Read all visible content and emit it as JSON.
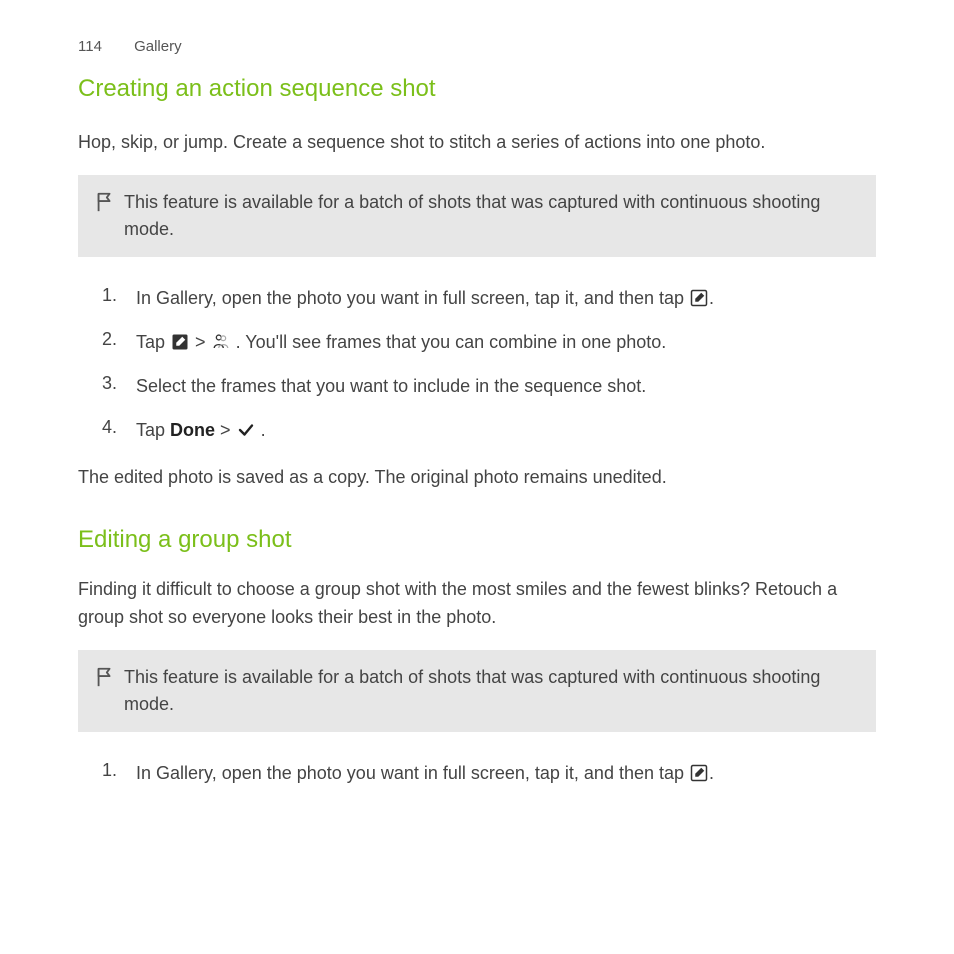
{
  "header": {
    "page_number": "114",
    "chapter": "Gallery"
  },
  "section1": {
    "title": "Creating an action sequence shot",
    "intro": "Hop, skip, or jump. Create a sequence shot to stitch a series of actions into one photo.",
    "note": "This feature is available for a batch of shots that was captured with continuous shooting mode.",
    "steps": {
      "s1_a": "In Gallery, open the photo you want in full screen, tap it, and then tap ",
      "s1_end": ".",
      "s2_a": "Tap ",
      "s2_gt": " > ",
      "s2_b": " . You'll see frames that you can combine in one photo.",
      "s3": "Select the frames that you want to include in the sequence shot.",
      "s4_a": "Tap ",
      "s4_done": "Done",
      "s4_gt": " > ",
      "s4_end": " ."
    },
    "outro": "The edited photo is saved as a copy. The original photo remains unedited."
  },
  "section2": {
    "title": "Editing a group shot",
    "intro": "Finding it difficult to choose a group shot with the most smiles and the fewest blinks? Retouch a group shot so everyone looks their best in the photo.",
    "note": "This feature is available for a batch of shots that was captured with continuous shooting mode.",
    "steps": {
      "s1_a": "In Gallery, open the photo you want in full screen, tap it, and then tap ",
      "s1_end": "."
    }
  },
  "step_numbers": {
    "n1": "1.",
    "n2": "2.",
    "n3": "3.",
    "n4": "4."
  }
}
